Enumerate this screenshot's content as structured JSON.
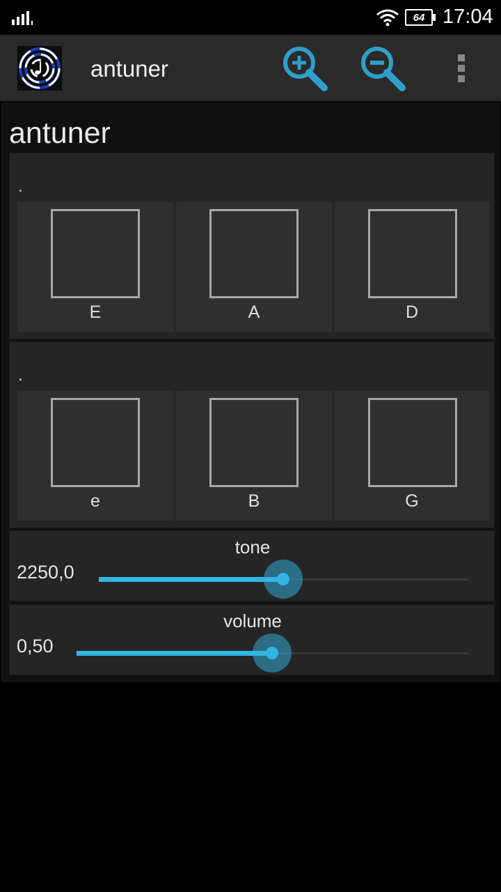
{
  "status_bar": {
    "time": "17:04",
    "battery_level": "64",
    "icons": [
      "signal-icon",
      "wifi-icon",
      "battery-icon"
    ]
  },
  "action_bar": {
    "app_name": "antuner",
    "icons": [
      "app-logo-icon",
      "zoom-in-icon",
      "zoom-out-icon",
      "overflow-menu-icon"
    ]
  },
  "main": {
    "title": "antuner",
    "groups": [
      {
        "label": ".",
        "strings": [
          "E",
          "A",
          "D"
        ]
      },
      {
        "label": ".",
        "strings": [
          "e",
          "B",
          "G"
        ]
      }
    ],
    "tone": {
      "label": "tone",
      "value_text": "2250,0",
      "fraction": 0.5
    },
    "volume": {
      "label": "volume",
      "value_text": "0,50",
      "fraction": 0.5
    }
  },
  "colors": {
    "accent": "#33b5e5",
    "action_bar": "#2a2a2a",
    "panel": "#252525",
    "button": "#2f2f2f"
  }
}
